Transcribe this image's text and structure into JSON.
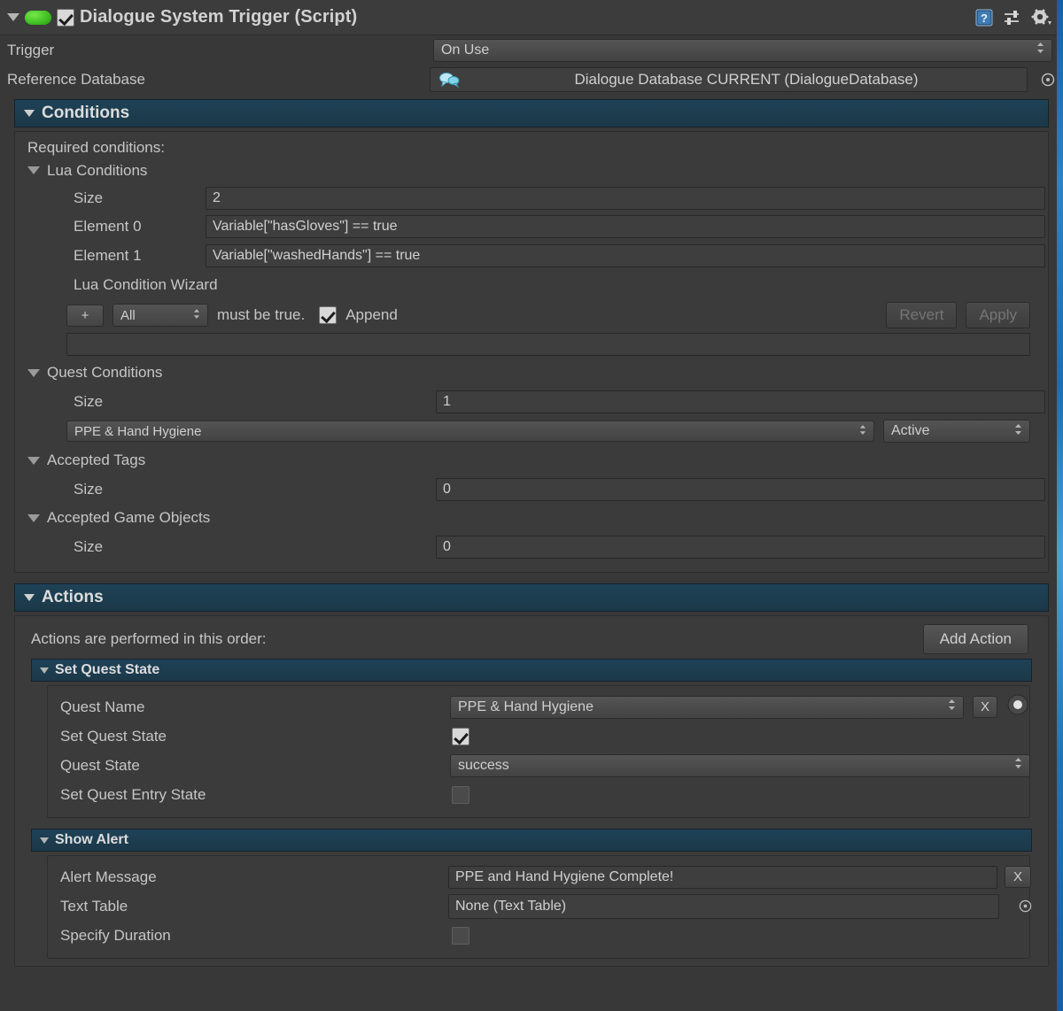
{
  "component": {
    "title": "Dialogue System Trigger (Script)",
    "enabled_checkbox": true,
    "help_icon": "help-book-icon",
    "preset_icon": "preset-sliders-icon",
    "settings_icon": "gear-icon"
  },
  "fields": {
    "trigger_label": "Trigger",
    "trigger_value": "On Use",
    "reference_database_label": "Reference Database",
    "reference_database_value": "Dialogue Database CURRENT (DialogueDatabase)"
  },
  "conditions": {
    "header": "Conditions",
    "required_label": "Required conditions:",
    "lua": {
      "header": "Lua Conditions",
      "size_label": "Size",
      "size_value": "2",
      "elements": [
        {
          "label": "Element 0",
          "value": "Variable[\"hasGloves\"] == true"
        },
        {
          "label": "Element 1",
          "value": "Variable[\"washedHands\"] == true"
        }
      ]
    },
    "wizard": {
      "label": "Lua Condition Wizard",
      "add_button": "+",
      "mode_value": "All",
      "must_be_true": "must be true.",
      "append_label": "Append",
      "append_checked": true,
      "revert_button": "Revert",
      "apply_button": "Apply",
      "preview_value": ""
    },
    "quest": {
      "header": "Quest Conditions",
      "size_label": "Size",
      "size_value": "1",
      "entries": [
        {
          "quest_name": "PPE & Hand Hygiene",
          "state": "Active"
        }
      ]
    },
    "accepted_tags": {
      "header": "Accepted Tags",
      "size_label": "Size",
      "size_value": "0"
    },
    "accepted_game_objects": {
      "header": "Accepted Game Objects",
      "size_label": "Size",
      "size_value": "0"
    }
  },
  "actions": {
    "header": "Actions",
    "order_note": "Actions are performed in this order:",
    "add_action_button": "Add Action",
    "set_quest_state": {
      "header": "Set Quest State",
      "quest_name_label": "Quest Name",
      "quest_name_value": "PPE & Hand Hygiene",
      "clear_button": "X",
      "record_button": "record-dot-icon",
      "set_quest_state_label": "Set Quest State",
      "set_quest_state_checked": true,
      "quest_state_label": "Quest State",
      "quest_state_value": "success",
      "set_quest_entry_state_label": "Set Quest Entry State",
      "set_quest_entry_state_checked": false
    },
    "show_alert": {
      "header": "Show Alert",
      "alert_message_label": "Alert Message",
      "alert_message_value": "PPE and Hand Hygiene Complete!",
      "clear_button": "X",
      "text_table_label": "Text Table",
      "text_table_value": "None (Text Table)",
      "specify_duration_label": "Specify Duration",
      "specify_duration_checked": false
    }
  },
  "colors": {
    "section_header": "#1f4257",
    "panel_bg": "#3b3b3b",
    "window_bg": "#383838",
    "enabled_indicator": "#4fd02a"
  }
}
